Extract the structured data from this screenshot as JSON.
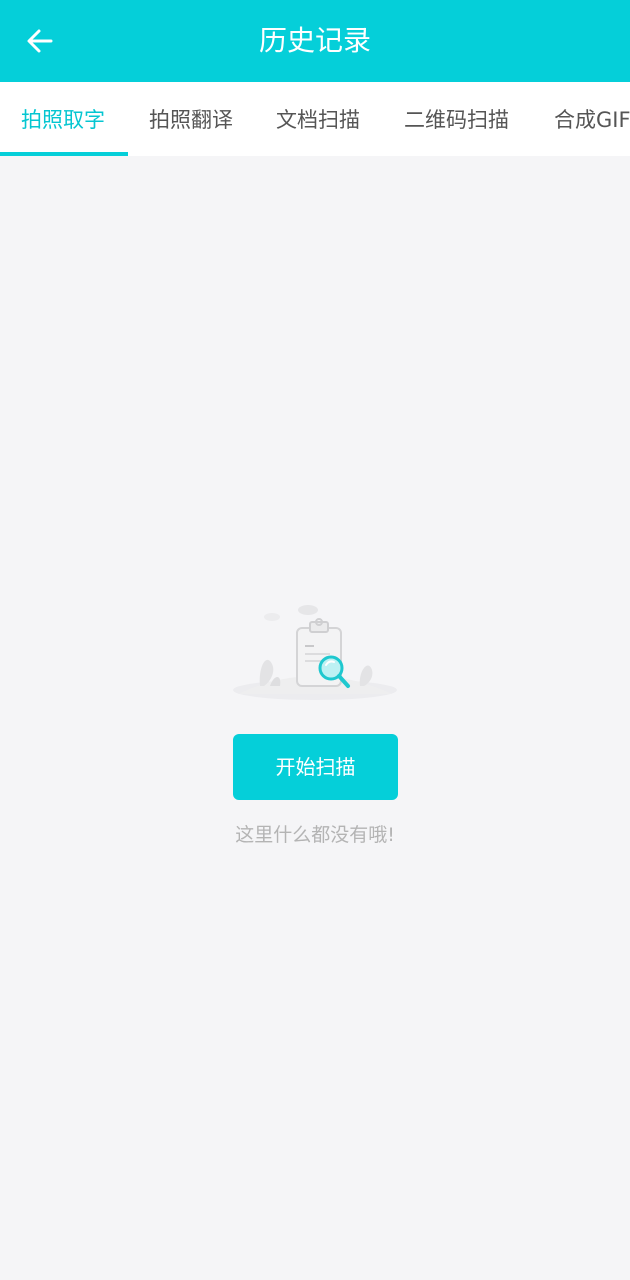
{
  "header": {
    "title": "历史记录"
  },
  "tabs": [
    {
      "label": "拍照取字",
      "active": true
    },
    {
      "label": "拍照翻译",
      "active": false
    },
    {
      "label": "文档扫描",
      "active": false
    },
    {
      "label": "二维码扫描",
      "active": false
    },
    {
      "label": "合成GIF",
      "active": false
    }
  ],
  "empty_state": {
    "button_label": "开始扫描",
    "message": "这里什么都没有哦!"
  },
  "icons": {
    "back": "arrow-left-icon",
    "illustration": "clipboard-search-illustration"
  },
  "colors": {
    "accent": "#05cfd9",
    "tab_active_text": "#05c6d1",
    "background": "#f5f5f7",
    "muted_text": "#b4b4b4"
  }
}
